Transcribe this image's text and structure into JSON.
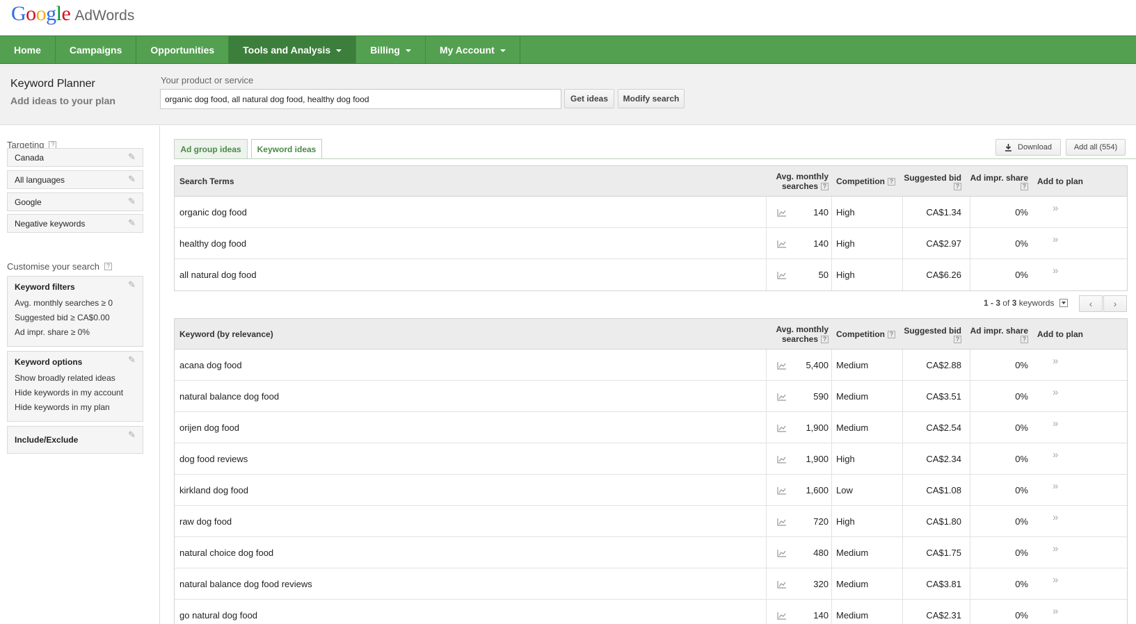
{
  "brand": {
    "google_letters": [
      {
        "ch": "G",
        "color": "#3369e8"
      },
      {
        "ch": "o",
        "color": "#d50f25"
      },
      {
        "ch": "o",
        "color": "#eeb211"
      },
      {
        "ch": "g",
        "color": "#3369e8"
      },
      {
        "ch": "l",
        "color": "#009925"
      },
      {
        "ch": "e",
        "color": "#d50f25"
      }
    ],
    "product": "AdWords"
  },
  "nav": [
    {
      "label": "Home",
      "caret": false,
      "active": false
    },
    {
      "label": "Campaigns",
      "caret": false,
      "active": false
    },
    {
      "label": "Opportunities",
      "caret": false,
      "active": false
    },
    {
      "label": "Tools and Analysis",
      "caret": true,
      "active": true
    },
    {
      "label": "Billing",
      "caret": true,
      "active": false
    },
    {
      "label": "My Account",
      "caret": true,
      "active": false
    }
  ],
  "subheader": {
    "title": "Keyword Planner",
    "subtitle": "Add ideas to your plan",
    "service_label": "Your product or service",
    "service_value": "organic dog food, all natural dog food, healthy dog food",
    "get_ideas": "Get ideas",
    "modify_search": "Modify search"
  },
  "sidebar": {
    "targeting_label": "Targeting",
    "help": "?",
    "targeting": [
      "Canada",
      "All languages",
      "Google",
      "Negative keywords"
    ],
    "customise_label": "Customise your search",
    "keyword_filters": {
      "title": "Keyword filters",
      "lines": [
        "Avg. monthly searches ≥ 0",
        "Suggested bid ≥ CA$0.00",
        "Ad impr. share ≥ 0%"
      ]
    },
    "keyword_options": {
      "title": "Keyword options",
      "lines": [
        "Show broadly related ideas",
        "Hide keywords in my account",
        "Hide keywords in my plan"
      ]
    },
    "include_exclude": "Include/Exclude"
  },
  "tabs": {
    "ad_group": "Ad group ideas",
    "keyword": "Keyword ideas"
  },
  "toolbar": {
    "download": "Download",
    "add_all": "Add all (554)"
  },
  "columns": {
    "avg_line1": "Avg. monthly",
    "avg_line2": "searches",
    "competition": "Competition",
    "bid": "Suggested bid",
    "impr": "Ad impr. share",
    "add": "Add to plan",
    "help": "?"
  },
  "search_terms": {
    "header": "Search Terms",
    "rows": [
      {
        "term": "organic dog food",
        "searches": "140",
        "competition": "High",
        "bid": "CA$1.34",
        "share": "0%"
      },
      {
        "term": "healthy dog food",
        "searches": "140",
        "competition": "High",
        "bid": "CA$2.97",
        "share": "0%"
      },
      {
        "term": "all natural dog food",
        "searches": "50",
        "competition": "High",
        "bid": "CA$6.26",
        "share": "0%"
      }
    ]
  },
  "pager": {
    "range": "1 - 3",
    "of": " of ",
    "total": "3",
    "suffix": " keywords"
  },
  "keywords": {
    "header": "Keyword (by relevance)",
    "rows": [
      {
        "term": "acana dog food",
        "searches": "5,400",
        "competition": "Medium",
        "bid": "CA$2.88",
        "share": "0%"
      },
      {
        "term": "natural balance dog food",
        "searches": "590",
        "competition": "Medium",
        "bid": "CA$3.51",
        "share": "0%"
      },
      {
        "term": "orijen dog food",
        "searches": "1,900",
        "competition": "Medium",
        "bid": "CA$2.54",
        "share": "0%"
      },
      {
        "term": "dog food reviews",
        "searches": "1,900",
        "competition": "High",
        "bid": "CA$2.34",
        "share": "0%"
      },
      {
        "term": "kirkland dog food",
        "searches": "1,600",
        "competition": "Low",
        "bid": "CA$1.08",
        "share": "0%"
      },
      {
        "term": "raw dog food",
        "searches": "720",
        "competition": "High",
        "bid": "CA$1.80",
        "share": "0%"
      },
      {
        "term": "natural choice dog food",
        "searches": "480",
        "competition": "Medium",
        "bid": "CA$1.75",
        "share": "0%"
      },
      {
        "term": "natural balance dog food reviews",
        "searches": "320",
        "competition": "Medium",
        "bid": "CA$3.81",
        "share": "0%"
      },
      {
        "term": "go natural dog food",
        "searches": "140",
        "competition": "Medium",
        "bid": "CA$2.31",
        "share": "0%"
      }
    ]
  },
  "icons": {
    "pencil": "pencil-icon",
    "chart": "trend-chart-icon",
    "add": "double-chevron-right-icon",
    "download": "download-icon",
    "prev": "chevron-left-icon",
    "next": "chevron-right-icon",
    "caret": "caret-down-icon"
  }
}
